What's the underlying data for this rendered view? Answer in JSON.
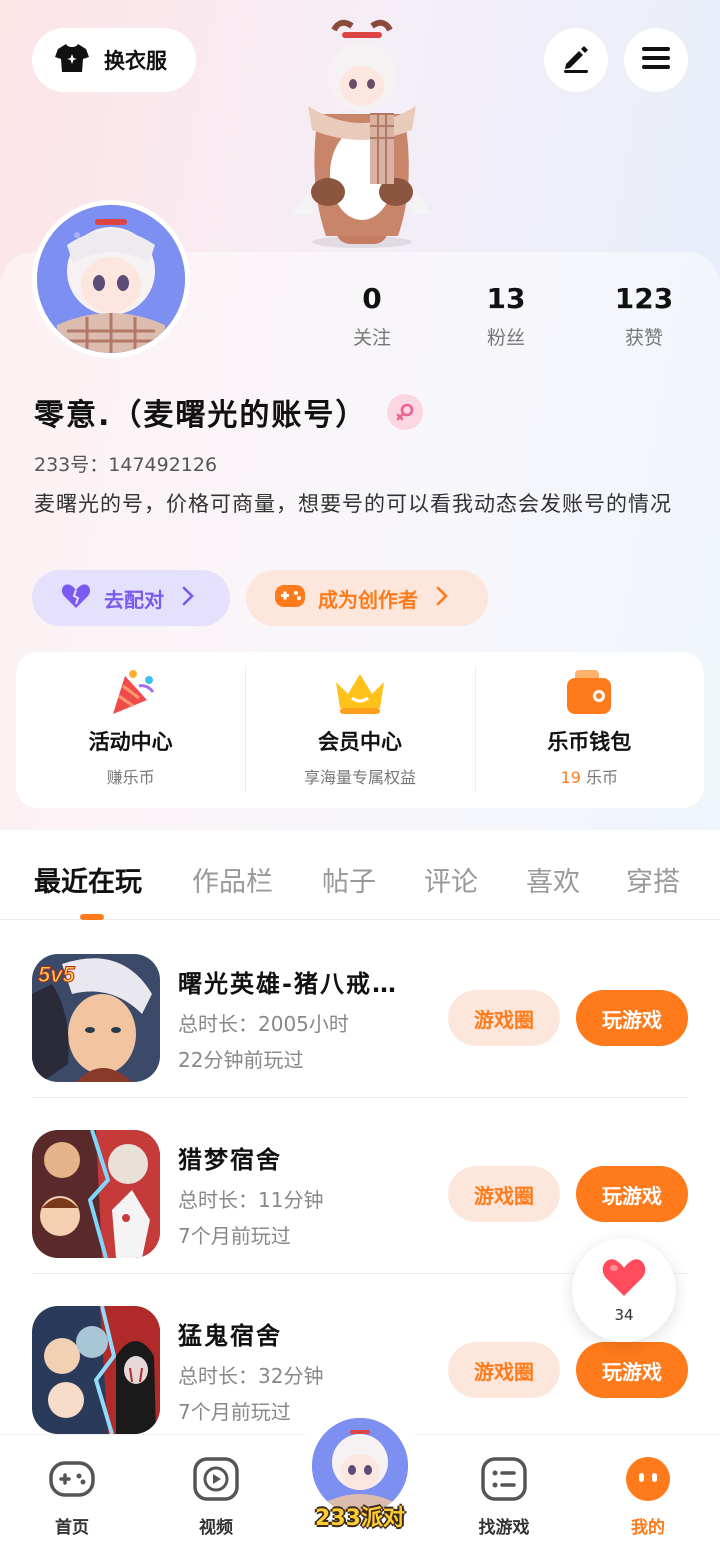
{
  "header": {
    "wardrobe_label": "换衣服",
    "edit_icon": "pencil-icon",
    "menu_icon": "hamburger-icon"
  },
  "profile": {
    "stats": [
      {
        "value": "0",
        "label": "关注"
      },
      {
        "value": "13",
        "label": "粉丝"
      },
      {
        "value": "123",
        "label": "获赞"
      }
    ],
    "name": "零意.（麦曙光的账号）",
    "gender": "female",
    "uid": "233号：147492126",
    "bio": "麦曙光的号，价格可商量，想要号的可以看我动态会发账号的情况",
    "match_label": "去配对",
    "creator_label": "成为创作者"
  },
  "services": [
    {
      "title": "活动中心",
      "sub": "赚乐币"
    },
    {
      "title": "会员中心",
      "sub": "享海量专属权益"
    },
    {
      "title": "乐币钱包",
      "sub_count": "19",
      "sub_unit": "乐币"
    }
  ],
  "tabs": [
    "最近在玩",
    "作品栏",
    "帖子",
    "评论",
    "喜欢",
    "穿搭"
  ],
  "active_tab": 0,
  "games": [
    {
      "name": "曙光英雄-猪八戒…",
      "duration": "总时长：2005小时",
      "last_played": "22分钟前玩过",
      "circle_label": "游戏圈",
      "play_label": "玩游戏",
      "badge": "5v5"
    },
    {
      "name": "猎梦宿舍",
      "duration": "总时长：11分钟",
      "last_played": "7个月前玩过",
      "circle_label": "游戏圈",
      "play_label": "玩游戏"
    },
    {
      "name": "猛鬼宿舍",
      "duration": "总时长：32分钟",
      "last_played": "7个月前玩过",
      "circle_label": "游戏圈",
      "play_label": "玩游戏"
    }
  ],
  "float_like": {
    "count": "34"
  },
  "nav": {
    "items": [
      "首页",
      "视频",
      "找游戏",
      "我的"
    ],
    "center_label": "233派对",
    "active": "我的"
  },
  "colors": {
    "accent": "#ff7a1a",
    "purple": "#7a5af0",
    "pill_purple_bg": "#e5e0fb",
    "pill_orange_bg": "#fde7dc"
  }
}
